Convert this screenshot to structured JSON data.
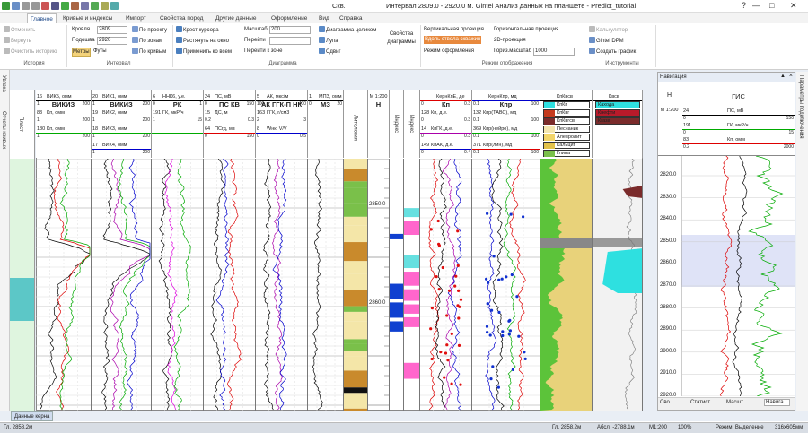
{
  "window": {
    "doc_title": "Скв.",
    "title": "Интервал 2809.0 - 2920.0 м. Gintel Анализ данных на планшете - Predict_tutorial",
    "help": "?"
  },
  "tabs": [
    "Главное",
    "Кривые и индексы",
    "Импорт",
    "Свойства пород",
    "Другие данные",
    "Оформление",
    "Вид",
    "Справка"
  ],
  "ribbon": {
    "history": {
      "undo": "Отменить",
      "redo": "Вернуть",
      "clear": "Очистить историю",
      "label": "История"
    },
    "interval": {
      "roof_label": "Кровля",
      "roof_value": "2809",
      "sole_label": "Подошва",
      "sole_value": "2920",
      "unit_m": "Метры",
      "unit_ft": "Футы",
      "by_project": "По проекту",
      "by_zones": "По зонам",
      "by_curves": "По кривым",
      "label": "Интервал"
    },
    "diagram": {
      "crosshair": "Крест курсора",
      "stretch": "Растянуть на окно",
      "apply_all": "Применить ко всем",
      "scale_label": "Масштаб",
      "scale_value": "200",
      "goto1": "Перейти",
      "goto2": "Перейти",
      "goto_zone": "Перейти к зоне",
      "diag_whole": "Диаграмма целиком",
      "zoom": "Лупа",
      "shift": "Сдвиг",
      "props": "Свойства диаграммы",
      "label": "Диаграмма"
    },
    "display": {
      "vert_proj": "Вертикальная проекция",
      "along_hole": "Вдоль ствола скважин",
      "hor_proj": "Горизонтальная проекция",
      "proj2d": "2D-проекция",
      "mode": "Режим оформления",
      "hor_scale": "Гориз.масштаб",
      "hor_scale_value": "1000",
      "label": "Режим отображения"
    },
    "tools": {
      "calc": "Калькулятор",
      "dpm": "Gintel DPM",
      "create_chart": "Создать график",
      "label": "Инструменты"
    }
  },
  "left_tabs": [
    "Увязка",
    "Отчеты кривых"
  ],
  "left_header": "Пласт",
  "tracks": [
    {
      "name": "ВИКИЗ",
      "curves": [
        {
          "n": "16",
          "t": "ВИК5, омм",
          "c": "#000"
        },
        {
          "n": "83",
          "t": "Кп, омм",
          "c": "#d00"
        },
        {
          "n": "180",
          "t": "Кп, омм",
          "c": "#0a0"
        }
      ],
      "scales": [
        [
          "1",
          "",
          "200"
        ],
        [
          "1",
          "",
          "200"
        ],
        [
          "1",
          "",
          "200"
        ]
      ]
    },
    {
      "name": "ВИКИЗ",
      "curves": [
        {
          "n": "20",
          "t": "ВИК1, омм",
          "c": "#000"
        },
        {
          "n": "19",
          "t": "ВИК2, омм",
          "c": "#a0a"
        },
        {
          "n": "18",
          "t": "ВИК3, омм",
          "c": "#0a0"
        },
        {
          "n": "17",
          "t": "ВИК4, омм",
          "c": "#00c"
        }
      ],
      "scales": [
        [
          "1",
          "",
          "200"
        ],
        [
          "1",
          "",
          "200"
        ],
        [
          "1",
          "",
          "200"
        ],
        [
          "1",
          "",
          "200"
        ]
      ]
    },
    {
      "name": "РК",
      "curves": [
        {
          "n": "6",
          "t": "ННК6, у.е.",
          "c": "#000"
        },
        {
          "n": "191",
          "t": "ГК, мкР/ч",
          "c": "#d0d"
        },
        {
          "n": "",
          "t": "",
          "c": "#0a0"
        }
      ],
      "scales": [
        [
          "0",
          "",
          "1"
        ],
        [
          "1",
          "",
          "15"
        ],
        [
          "",
          "",
          ""
        ]
      ]
    },
    {
      "name": "ПС КВ",
      "curves": [
        {
          "n": "24",
          "t": "ПС, мВ",
          "c": "#000"
        },
        {
          "n": "15",
          "t": "ДС, м",
          "c": "#00c"
        },
        {
          "n": "64",
          "t": "ПСгд, мв",
          "c": "#d00"
        }
      ],
      "scales": [
        [
          "0",
          "",
          "150"
        ],
        [
          "0.2",
          "",
          "0.3"
        ],
        [
          "0",
          "",
          "150"
        ]
      ]
    },
    {
      "name": "АК ГГК-П НК",
      "curves": [
        {
          "n": "5",
          "t": "АК, мкс/м",
          "c": "#000"
        },
        {
          "n": "163",
          "t": "ГГК, г/см3",
          "c": "#a0a"
        },
        {
          "n": "8",
          "t": "Wнк, V/V",
          "c": "#00c"
        }
      ],
      "scales": [
        [
          "100",
          "",
          "400"
        ],
        [
          "2",
          "",
          "3"
        ],
        [
          "0",
          "",
          "0.5"
        ]
      ]
    },
    {
      "name": "МЗ",
      "curves": [
        {
          "n": "1",
          "t": "МПЗ, омм",
          "c": "#000"
        }
      ],
      "scales": [
        [
          "0",
          "",
          "20"
        ]
      ]
    },
    {
      "name": "Литология",
      "curves": [],
      "scales": []
    },
    {
      "name": "Н",
      "curves": [
        {
          "n": "",
          "t": "М 1:200",
          "c": "#000"
        }
      ],
      "scales": []
    },
    {
      "name": "Индекс",
      "curves": [],
      "scales": []
    },
    {
      "name": "Индекс",
      "curves": [],
      "scales": []
    },
    {
      "name": "Кп",
      "curves": [
        {
          "n": "",
          "t": "КернКпЕ, де",
          "c": "#d00"
        },
        {
          "n": "128",
          "t": "Кп, д.е.",
          "c": "#000"
        },
        {
          "n": "14",
          "t": "КпГК, д.е.",
          "c": "#a0a"
        },
        {
          "n": "149",
          "t": "КпАК, д.е.",
          "c": "#00c"
        }
      ],
      "scales": [
        [
          "0",
          "",
          "0.3"
        ],
        [
          "0",
          "",
          "0.3"
        ],
        [
          "0",
          "",
          "0.3"
        ],
        [
          "0",
          "",
          "0.4"
        ]
      ]
    },
    {
      "name": "Кпр",
      "curves": [
        {
          "n": "",
          "t": "КернКпр, мд",
          "c": "#00c"
        },
        {
          "n": "132",
          "t": "Кпр(ТАВС), мд",
          "c": "#000"
        },
        {
          "n": "369",
          "t": "Кпр(нейро), мд",
          "c": "#0a0"
        },
        {
          "n": "371",
          "t": "Кпр(лин), мд",
          "c": "#d00"
        }
      ],
      "scales": [
        [
          "0.1",
          "",
          "100"
        ],
        [
          "0.1",
          "",
          "100"
        ],
        [
          "0.1",
          "",
          "100"
        ],
        [
          "0.1",
          "",
          "100"
        ]
      ]
    },
    {
      "name": "МОДЕЛЬ",
      "curves": [
        {
          "n": "",
          "t": "КпКвсв",
          "c": "#000"
        }
      ],
      "legend": [
        "КпКп",
        "КпКвг",
        "КпКвгсв",
        "Песчаник",
        "Алевролит",
        "Кальцит",
        "Глина"
      ]
    },
    {
      "name": "ФЛЮИДЫ",
      "curves": [
        {
          "n": "",
          "t": "Квсв",
          "c": "#000"
        }
      ],
      "legend": [
        "Кахода",
        "Кнефти",
        "Кгаза"
      ]
    }
  ],
  "depth_labels": [
    "2850.0",
    "2860.0"
  ],
  "nav": {
    "title": "Навигация",
    "h_header": "Н",
    "gis_header": "ГИС",
    "scale": "М 1:200",
    "curves": [
      {
        "n": "24",
        "t": "ПС, мВ",
        "min": "0",
        "max": "150"
      },
      {
        "n": "191",
        "t": "ГК, мкР/ч",
        "min": "0",
        "max": "15"
      },
      {
        "n": "83",
        "t": "Кп, омм",
        "min": "0.2",
        "max": "2000"
      }
    ],
    "depths": [
      "2820.0",
      "2830.0",
      "2840.0",
      "2850.0",
      "2860.0",
      "2870.0",
      "2880.0",
      "2890.0",
      "2900.0",
      "2910.0",
      "2920.0"
    ]
  },
  "right_vtab": "Параметры подключения",
  "bottom_tabs": [
    "Сво...",
    "Статист...",
    "Масшт...",
    "Навига..."
  ],
  "core_tab": "Данные керна",
  "status": {
    "left": "Гл. 2858.2м",
    "depth": "Гл. 2858.2м",
    "abs": "Абсл. -2788.1м",
    "scale": "М1:200",
    "zoom": "100%",
    "mode": "Режим: Выделение",
    "size": "316x605мм"
  },
  "colors": {
    "accent": "#1f4a8a",
    "ribbon_hl": "#f3d27a",
    "selection": "#e8893d"
  }
}
